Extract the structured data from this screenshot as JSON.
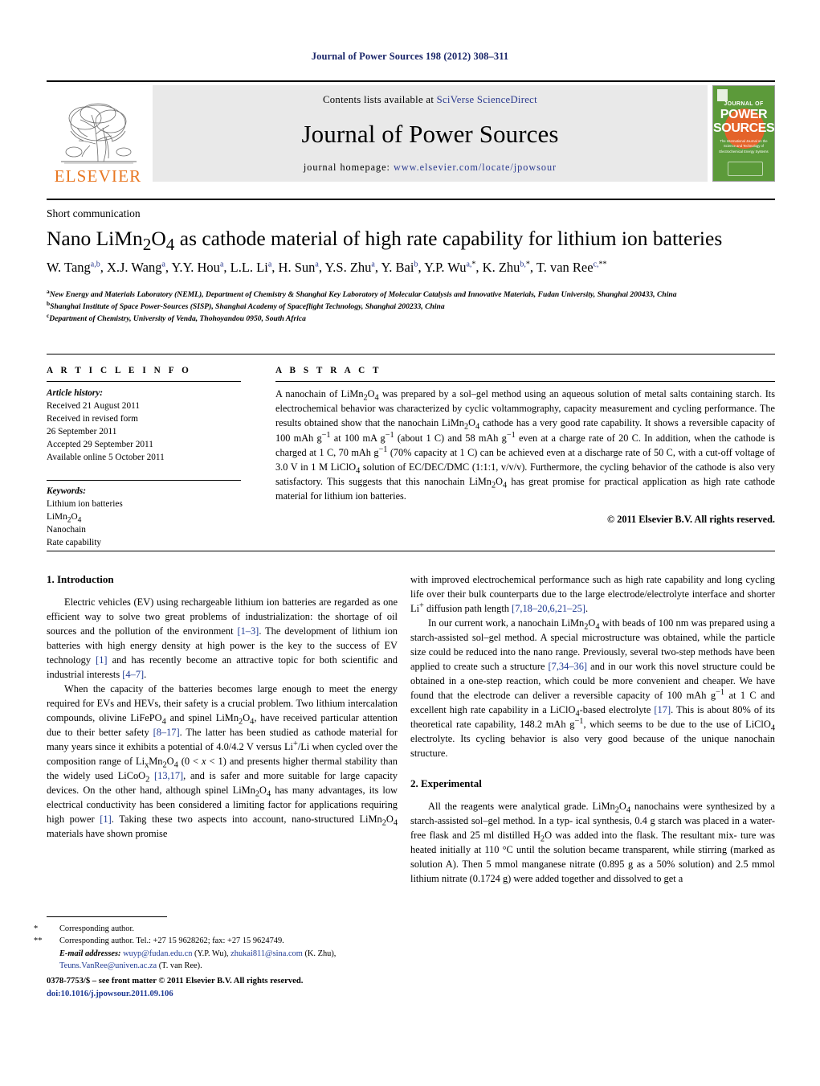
{
  "running_head": "Journal of Power Sources 198 (2012) 308–311",
  "masthead": {
    "publisher_name": "ELSEVIER",
    "contents_prefix": "Contents lists available at ",
    "contents_link": "SciVerse ScienceDirect",
    "journal_title": "Journal of Power Sources",
    "homepage_label": "journal homepage: ",
    "homepage_url": "www.elsevier.com/locate/jpowsour",
    "cover": {
      "line1": "JOURNAL OF",
      "line2": "POWER",
      "line3": "SOURCES",
      "subtitle": "The International Journal on the Science and Technology of Electrochemical Energy Systems",
      "bg_color": "#5c9a3a",
      "accent_color": "#e4632a"
    }
  },
  "article": {
    "type": "Short communication",
    "title_parts": {
      "p1": "Nano LiMn",
      "sub1": "2",
      "p2": "O",
      "sub2": "4",
      "p3": " as cathode material of high rate capability for lithium ion batteries"
    },
    "authors": "W. Tang a,b, X.J. Wang a, Y.Y. Hou a, L.L. Li a, H. Sun a, Y.S. Zhu a, Y. Bai b, Y.P. Wu a,*, K. Zhu b,*, T. van Ree c,**",
    "affiliations": [
      {
        "mark": "a",
        "text": "New Energy and Materials Laboratory (NEML), Department of Chemistry & Shanghai Key Laboratory of Molecular Catalysis and Innovative Materials, Fudan University, Shanghai 200433, China"
      },
      {
        "mark": "b",
        "text": "Shanghai Institute of Space Power-Sources (SISP), Shanghai Academy of Spaceflight Technology, Shanghai 200233, China"
      },
      {
        "mark": "c",
        "text": "Department of Chemistry, University of Venda, Thohoyandou 0950, South Africa"
      }
    ]
  },
  "article_info": {
    "heading": "A R T I C L E   I N F O",
    "history_label": "Article history:",
    "history": [
      "Received 21 August 2011",
      "Received in revised form",
      "26 September 2011",
      "Accepted 29 September 2011",
      "Available online 5 October 2011"
    ],
    "keywords_label": "Keywords:",
    "keywords": [
      "Lithium ion batteries",
      "LiMn2O4",
      "Nanochain",
      "Rate capability"
    ]
  },
  "abstract": {
    "heading": "A B S T R A C T",
    "copyright": "© 2011 Elsevier B.V. All rights reserved."
  },
  "sections": {
    "introduction_title": "1.  Introduction",
    "experimental_title": "2.  Experimental"
  },
  "footnotes": {
    "corr1": "Corresponding author.",
    "corr2": "Corresponding author. Tel.: +27 15 9628262; fax: +27 15 9624749.",
    "email_label": "E-mail addresses:",
    "email1": "wuyp@fudan.edu.cn",
    "email1_owner": "(Y.P. Wu),",
    "email2": "zhukai811@sina.com",
    "email2_owner": "(K. Zhu),",
    "email3": "Teuns.VanRee@univen.ac.za",
    "email3_owner": "(T. van Ree)."
  },
  "imprint": {
    "issn_line": "0378-7753/$ – see front matter © 2011 Elsevier B.V. All rights reserved.",
    "doi": "doi:10.1016/j.jpowsour.2011.09.106"
  }
}
